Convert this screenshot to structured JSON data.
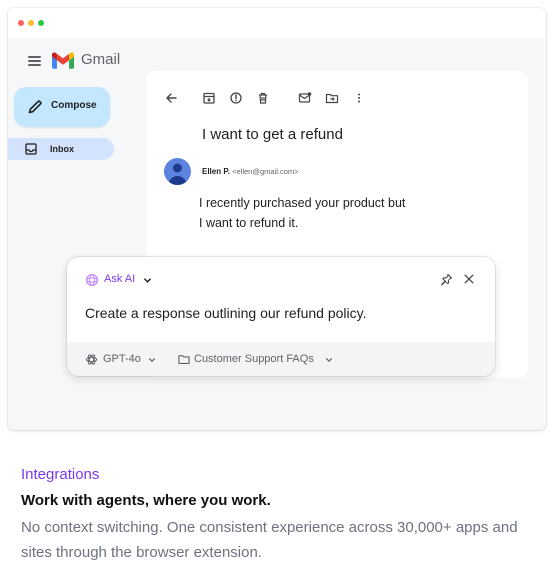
{
  "colors": {
    "accent": "#7c3aed",
    "compose_bg": "#c2e7ff",
    "inbox_bg": "#d3e3fd",
    "window_dots": [
      "#ff5f57",
      "#febc2e",
      "#28c840"
    ]
  },
  "gmail": {
    "app_name": "Gmail",
    "compose_label": "Compose",
    "inbox_label": "Inbox",
    "toolbar_icons": [
      "back-arrow-icon",
      "archive-icon",
      "report-spam-icon",
      "delete-icon",
      "mark-unread-icon",
      "move-to-icon",
      "more-vert-icon"
    ],
    "email": {
      "subject": "I want to get a refund",
      "sender_name": "Ellen P.",
      "sender_email": "<ellen@gmail.com>",
      "body_line1": "I recently purchased your product but",
      "body_line2": "I want to refund it."
    }
  },
  "ask_ai": {
    "label": "Ask AI",
    "prompt": "Create a response outlining our refund policy.",
    "model": "GPT-4o",
    "source": "Customer Support FAQs"
  },
  "marketing": {
    "eyebrow": "Integrations",
    "headline": "Work with agents, where you work.",
    "description": "No context switching. One consistent experience across 30,000+ apps and sites through the browser extension."
  }
}
